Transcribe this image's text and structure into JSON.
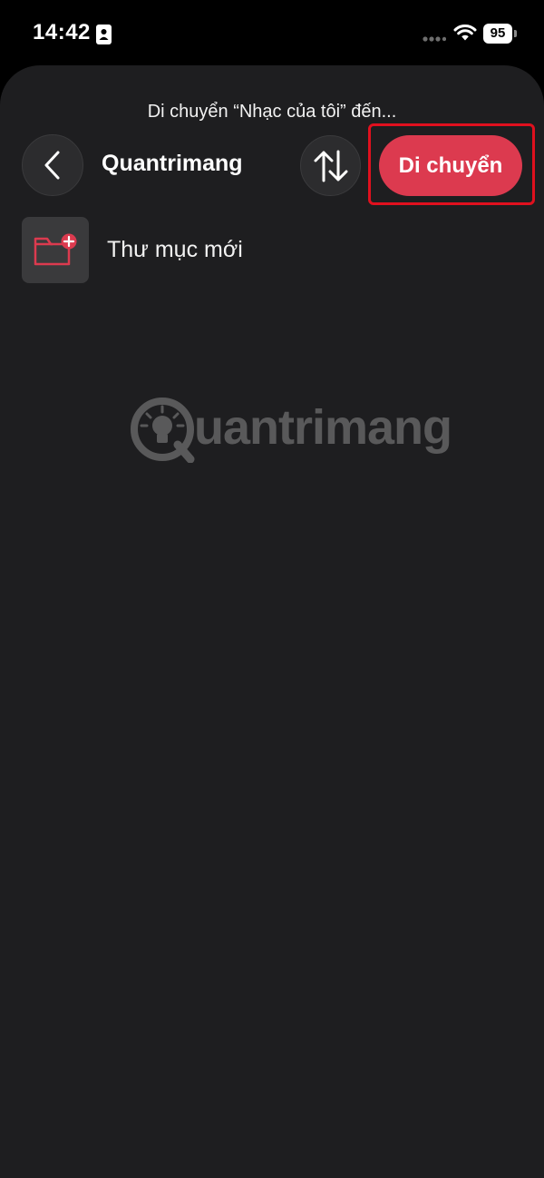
{
  "status_bar": {
    "time": "14:42",
    "battery": "95"
  },
  "sheet": {
    "title": "Di chuyển “Nhạc của tôi” đến...",
    "folder_name": "Quantrimang",
    "move_label": "Di chuyển",
    "new_folder_label": "Thư mục mới"
  },
  "watermark": {
    "text": "uantrimang",
    "logo_letter": "Q"
  },
  "colors": {
    "accent": "#dc3a4f",
    "highlight_border": "#e0101e",
    "sheet_bg": "#1e1e20"
  }
}
